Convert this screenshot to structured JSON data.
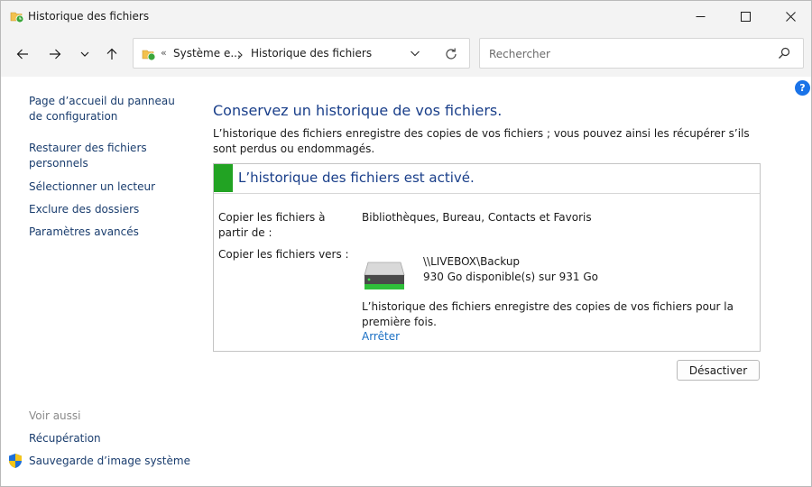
{
  "window": {
    "title": "Historique des fichiers"
  },
  "address": {
    "overflow_glyph": "«",
    "crumb1": "Système e...",
    "crumb2": "Historique des fichiers"
  },
  "search": {
    "placeholder": "Rechercher"
  },
  "sidebar": {
    "links": [
      {
        "label": "Page d’accueil du panneau de configuration"
      },
      {
        "label": "Restaurer des fichiers personnels"
      },
      {
        "label": "Sélectionner un lecteur"
      },
      {
        "label": "Exclure des dossiers"
      },
      {
        "label": "Paramètres avancés"
      }
    ],
    "see_also_label": "Voir aussi",
    "see_also": [
      {
        "label": "Récupération"
      },
      {
        "label": "Sauvegarde d’image système"
      }
    ]
  },
  "main": {
    "title": "Conservez un historique de vos fichiers.",
    "description": "L’historique des fichiers enregistre des copies de vos fichiers ; vous pouvez ainsi les récupérer s’ils sont perdus ou endommagés.",
    "status_title": "L’historique des fichiers est activé.",
    "copy_from_label": "Copier les fichiers à partir de :",
    "copy_from_value": "Bibliothèques, Bureau, Contacts et Favoris",
    "copy_to_label": "Copier les fichiers vers :",
    "drive_path": "\\\\LIVEBOX\\Backup",
    "drive_space": "930 Go disponible(s) sur 931 Go",
    "status_message": "L’historique des fichiers enregistre des copies de vos fichiers pour la première fois.",
    "stop_link": "Arrêter",
    "disable_button": "Désactiver"
  },
  "icons": {
    "help": "?",
    "status_color": "#22a323",
    "accent": "#1a3f8a"
  }
}
